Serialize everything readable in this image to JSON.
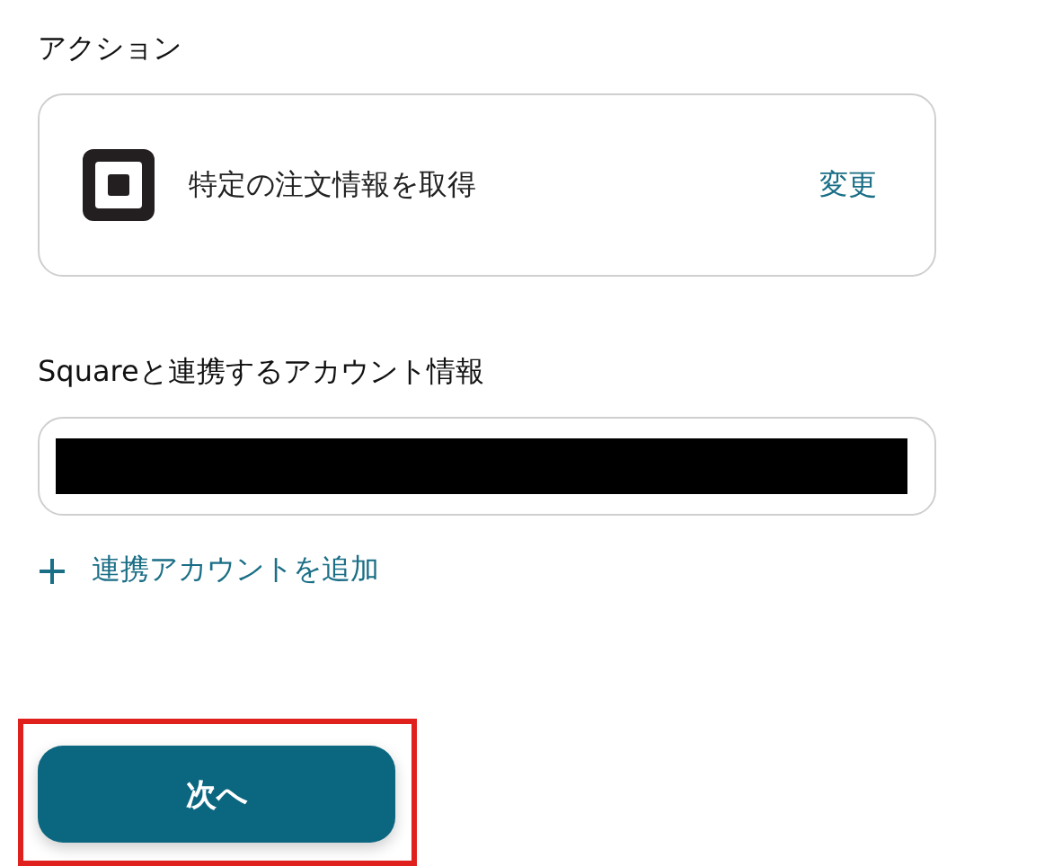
{
  "action_section": {
    "heading": "アクション",
    "card": {
      "title": "特定の注文情報を取得",
      "change_link": "変更"
    }
  },
  "account_section": {
    "label": "Squareと連携するアカウント情報",
    "field": {
      "redacted": true
    },
    "add_link": "連携アカウントを追加"
  },
  "next_button": {
    "label": "次へ",
    "highlighted": true
  }
}
